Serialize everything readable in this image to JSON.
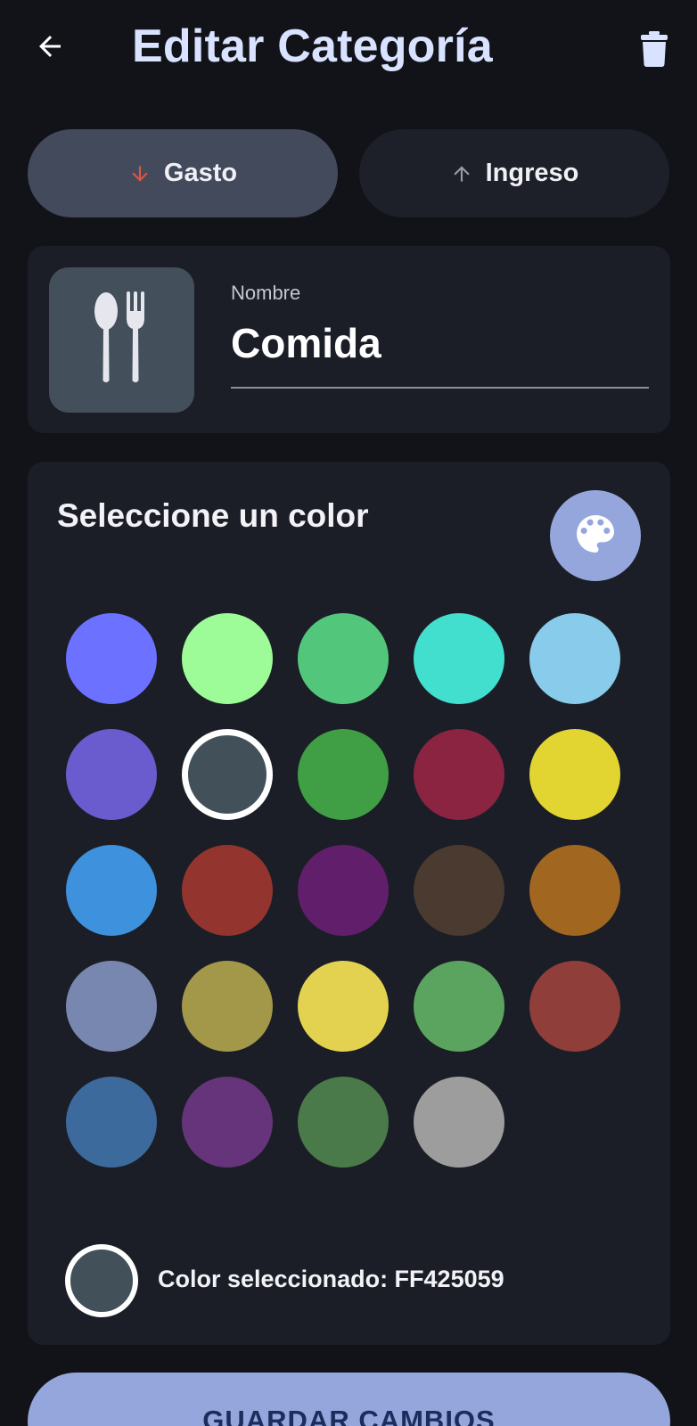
{
  "header": {
    "title": "Editar Categoría",
    "back_icon": "arrow-left-icon",
    "delete_icon": "trash-icon"
  },
  "type_toggle": {
    "options": [
      {
        "label": "Gasto",
        "icon": "arrow-down-icon",
        "icon_color": "#e5533d",
        "selected": true
      },
      {
        "label": "Ingreso",
        "icon": "arrow-up-icon",
        "icon_color": "#9a9ca3",
        "selected": false
      }
    ]
  },
  "name_card": {
    "icon": "fork-spoon-icon",
    "label": "Nombre",
    "value": "Comida"
  },
  "color_card": {
    "heading": "Seleccione un color",
    "palette_icon": "palette-icon",
    "colors": [
      "#6c72ff",
      "#9dfb98",
      "#52c77c",
      "#42dfcf",
      "#89cbeb",
      "#6a5ccf",
      "#425059",
      "#409e45",
      "#8b2441",
      "#e2d431",
      "#3e91dd",
      "#93352e",
      "#611f6b",
      "#4a3a30",
      "#a1661f",
      "#7887b0",
      "#a3974a",
      "#e3d24f",
      "#5aa45f",
      "#8f3e3a",
      "#3c6a9c",
      "#65347a",
      "#4a794a",
      "#9d9d9d"
    ],
    "selected_index": 6,
    "selected_color": "#425059",
    "selected_label": "Color seleccionado: FF425059"
  },
  "save_button": {
    "label": "GUARDAR CAMBIOS"
  }
}
